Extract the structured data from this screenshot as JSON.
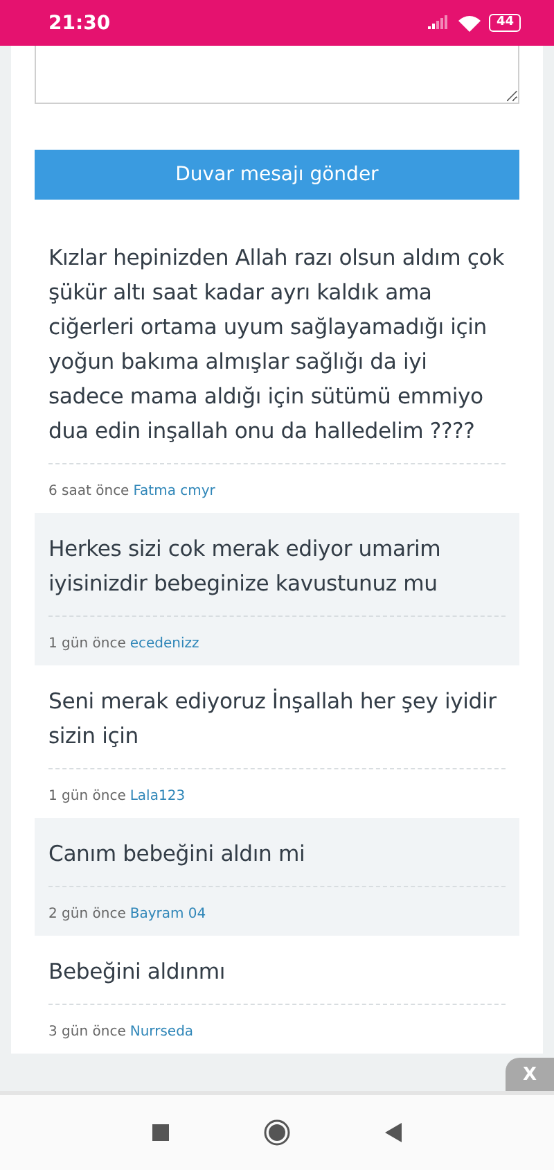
{
  "status_bar": {
    "time": "21:30",
    "battery": "44"
  },
  "send_button": "Duvar mesajı gönder",
  "posts": [
    {
      "text": "Kızlar hepinizden Allah razı olsun aldım çok şükür altı saat kadar ayrı kaldık ama ciğerleri ortama uyum sağlayamadığı için yoğun bakıma almışlar sağlığı da iyi sadece mama aldığı için sütümü emmiyo dua edin inşallah onu da halledelim ????",
      "time": "6 saat önce",
      "author": "Fatma cmyr"
    },
    {
      "text": "Herkes sizi cok merak ediyor umarim iyisinizdir bebeginize kavustunuz mu",
      "time": "1 gün önce",
      "author": "ecedenizz"
    },
    {
      "text": "Seni merak ediyoruz İnşallah her şey iyidir sizin için",
      "time": "1 gün önce",
      "author": "Lala123"
    },
    {
      "text": "Canım bebeğini aldın mi",
      "time": "2 gün önce",
      "author": "Bayram 04"
    },
    {
      "text": "Bebeğini aldınmı",
      "time": "3 gün önce",
      "author": "Nurrseda"
    }
  ],
  "close_tab": "X"
}
